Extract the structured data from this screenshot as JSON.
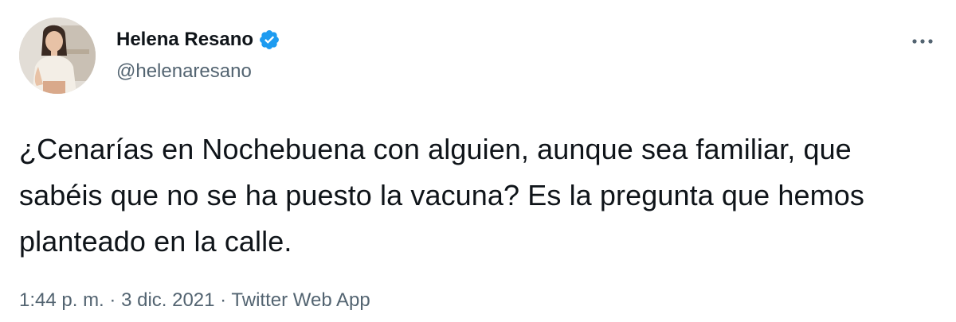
{
  "tweet": {
    "display_name": "Helena Resano",
    "handle": "@helenaresano",
    "verified": true,
    "text": "¿Cenarías en Nochebuena con alguien, aunque sea familiar, que sabéis que no se ha puesto la vacuna? Es la pregunta que hemos planteado en la calle.",
    "time": "1:44 p. m.",
    "separator": "·",
    "date": "3 dic. 2021",
    "source": "Twitter Web App"
  },
  "icons": {
    "verified": "verified-badge-icon",
    "more": "more-options-icon"
  },
  "colors": {
    "text": "#0f1419",
    "secondary": "#536471",
    "verified": "#1d9bf0",
    "background": "#ffffff"
  }
}
